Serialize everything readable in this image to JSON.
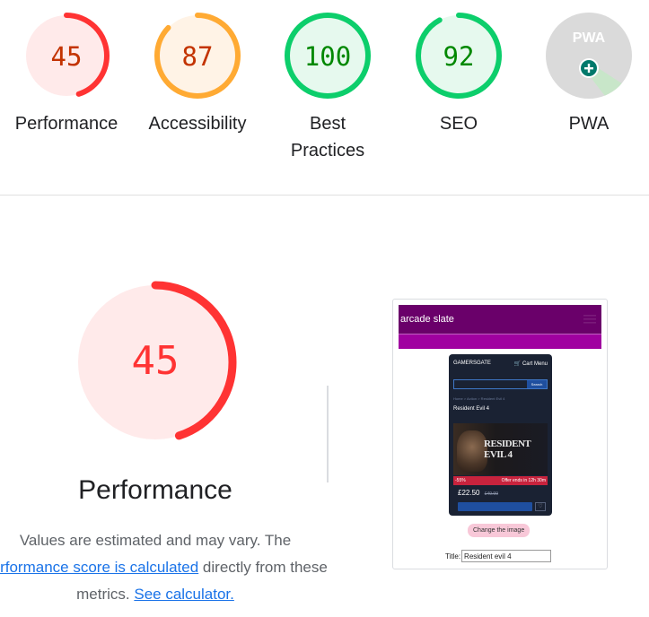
{
  "gauges": [
    {
      "score": "45",
      "label": "Performance",
      "value": 45,
      "color": "#ff3333",
      "text_color": "#c33300",
      "fill": "#ffeaea"
    },
    {
      "score": "87",
      "label": "Accessibility",
      "value": 87,
      "color": "#ffaa33",
      "text_color": "#c33300",
      "fill": "#fff3e6"
    },
    {
      "score": "100",
      "label_line1": "Best",
      "label_line2": "Practices",
      "value": 100,
      "color": "#0cce6b",
      "text_color": "#008800",
      "fill": "#e6f9ee"
    },
    {
      "score": "92",
      "label": "SEO",
      "value": 92,
      "color": "#0cce6b",
      "text_color": "#008800",
      "fill": "#e6f9ee"
    },
    {
      "badge": "PWA",
      "label": "PWA",
      "icon": "pwa-plus-icon"
    }
  ],
  "main": {
    "score": "45",
    "value": 45,
    "title": "Performance",
    "note_part1": "Values are estimated and may vary. The",
    "note_link1": "performance score is calculated",
    "note_part2": "directly from these",
    "note_part3": "metrics.",
    "note_link2": "See calculator."
  },
  "screenshot": {
    "site_title": "arcade slate",
    "logo": "GAMERSGATE",
    "cart": "Cart",
    "menu": "Menu",
    "search_btn": "Search",
    "crumb": "Home > Action > Resident Evil 4",
    "product_title": "Resident Evil 4",
    "cover_title": "RESIDENT EVIL 4",
    "discount": "-55%",
    "offer_note": "Offer ends in 12h 30m",
    "price": "£22.50",
    "old_price": "£49.99",
    "change_button": "Change the image",
    "form_label": "Title:",
    "form_value": "Resident evil 4"
  }
}
